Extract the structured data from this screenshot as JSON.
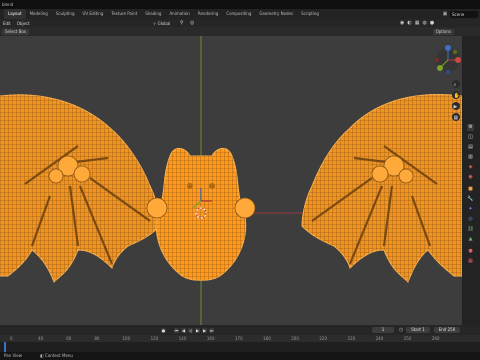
{
  "titlebar": {
    "title": "blend"
  },
  "workspaces": {
    "tabs": [
      "Layout",
      "Modeling",
      "Sculpting",
      "UV Editing",
      "Texture Paint",
      "Shading",
      "Animation",
      "Rendering",
      "Compositing",
      "Geometry Nodes",
      "Scripting"
    ],
    "active": "Layout",
    "scene_label": "Scene"
  },
  "viewport_header": {
    "mode": "Edit",
    "object_menu": "Object",
    "orientation": "Global"
  },
  "tool_header": {
    "select_box": "Select Box",
    "options": "Options"
  },
  "timeline": {
    "current_frame": "1",
    "start_label": "Start",
    "start_value": "1",
    "end_label": "End",
    "end_value": "250",
    "ruler": [
      "0",
      "40",
      "60",
      "80",
      "100",
      "120",
      "140",
      "160",
      "170",
      "180",
      "200",
      "220",
      "230",
      "240",
      "250",
      "260"
    ]
  },
  "statusbar": {
    "left": "Pan View",
    "center": "Context Menu"
  },
  "colors": {
    "wire": "#ff9a1f",
    "bg": "#3d3d3d",
    "x_axis": "#b23b3b",
    "y_axis": "#7ea12b",
    "accent": "#3b72c7"
  }
}
